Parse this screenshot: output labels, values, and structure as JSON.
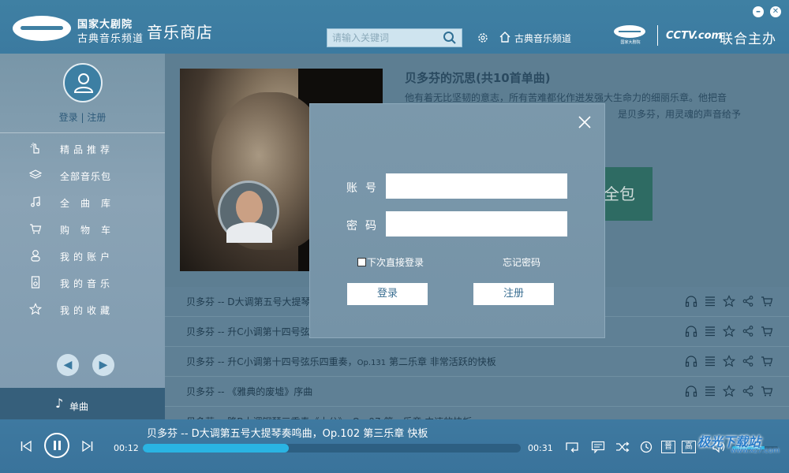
{
  "header": {
    "logo_line1": "国家大剧院",
    "logo_line2": "古典音乐频道",
    "store_title": "音乐商店",
    "search_placeholder": "请输入关键词",
    "channel_link": "古典音乐频道",
    "ncpa_caption": "国家大剧院",
    "cctv_logo": "CCTV.com",
    "co_host": "联合主办"
  },
  "sidebar": {
    "login": "登录",
    "separator": "|",
    "register": "注册",
    "items": [
      {
        "label": "精品推荐",
        "icon": "hand-pointer-icon"
      },
      {
        "label": "全部音乐包",
        "icon": "layers-icon"
      },
      {
        "label": "全曲库",
        "icon": "music-note-icon"
      },
      {
        "label": "购物车",
        "icon": "cart-icon"
      },
      {
        "label": "我的账户",
        "icon": "user-icon"
      },
      {
        "label": "我的音乐",
        "icon": "speaker-icon"
      },
      {
        "label": "我的收藏",
        "icon": "star-icon"
      }
    ],
    "prev_arrow": "◀",
    "next_arrow": "▶",
    "single_tab": "单曲",
    "single_note": "♪"
  },
  "album": {
    "title": "贝多芬的沉思(共10首单曲)",
    "desc_line1": "他有着无比坚韧的意志，所有苦难都化作迸发强大生命力的细丽乐章。他把音",
    "desc_line2": "是贝多芬，用灵魂的声音给予",
    "buy_all": "全包"
  },
  "tracks": [
    {
      "text": "贝多芬 -- D大调第五号大提琴"
    },
    {
      "text": "贝多芬 -- 升C小调第十四号弦"
    },
    {
      "text": "贝多芬 -- 升C小调第十四号弦乐四重奏，",
      "op": "Op.131",
      "rest": " 第二乐章 非常活跃的快板"
    },
    {
      "text": "贝多芬 -- 《雅典的废墟》序曲"
    },
    {
      "text": "贝多芬 -- 降B大调钢琴三重奏《大公》，Op.97 第一乐章 中速的快板"
    }
  ],
  "login_modal": {
    "account_label": "账号",
    "password_label": "密码",
    "account_value": "",
    "password_value": "",
    "remember_label": "下次直接登录",
    "forgot_label": "忘记密码",
    "login_button": "登录",
    "register_button": "注册"
  },
  "player": {
    "now_playing": "贝多芬 -- D大调第五号大提琴奏鸣曲，Op.102 第三乐章 快板",
    "current_time": "00:12",
    "total_time": "00:31",
    "progress_fraction": 0.387,
    "quality_1": "普",
    "quality_2": "高",
    "volume_fraction": 0.7
  },
  "watermark": {
    "text": "极光下载站",
    "url": "www.xz7.com"
  },
  "colors": {
    "header": "#3f80a3",
    "accent": "#2ab4e3",
    "buy_all": "#2e6b63"
  }
}
